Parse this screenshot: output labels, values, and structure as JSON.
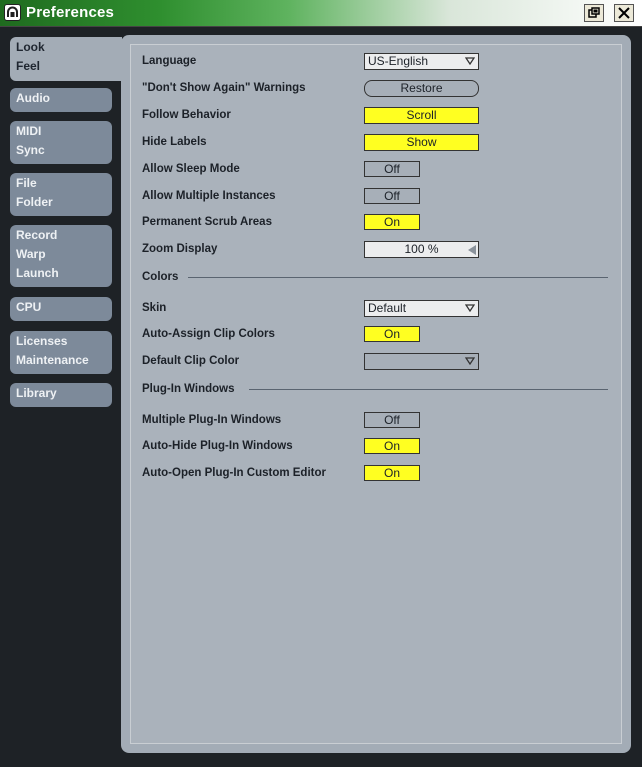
{
  "window": {
    "title": "Preferences"
  },
  "sidebar": {
    "tabs": [
      {
        "lines": [
          "Look",
          "Feel"
        ]
      },
      {
        "lines": [
          "Audio"
        ]
      },
      {
        "lines": [
          "MIDI",
          "Sync"
        ]
      },
      {
        "lines": [
          "File",
          "Folder"
        ]
      },
      {
        "lines": [
          "Record",
          "Warp",
          "Launch"
        ]
      },
      {
        "lines": [
          "CPU"
        ]
      },
      {
        "lines": [
          "Licenses",
          "Maintenance"
        ]
      },
      {
        "lines": [
          "Library"
        ]
      }
    ]
  },
  "settings": {
    "language": {
      "label": "Language",
      "value": "US-English"
    },
    "warnings": {
      "label": "\"Don't Show Again\" Warnings",
      "value": "Restore"
    },
    "follow": {
      "label": "Follow Behavior",
      "value": "Scroll"
    },
    "hide_labels": {
      "label": "Hide Labels",
      "value": "Show"
    },
    "sleep": {
      "label": "Allow Sleep Mode",
      "value": "Off"
    },
    "multi_instances": {
      "label": "Allow Multiple Instances",
      "value": "Off"
    },
    "scrub": {
      "label": "Permanent Scrub Areas",
      "value": "On"
    },
    "zoom": {
      "label": "Zoom Display",
      "value": "100 %"
    }
  },
  "colors": {
    "heading": "Colors",
    "skin": {
      "label": "Skin",
      "value": "Default"
    },
    "auto_assign": {
      "label": "Auto-Assign Clip Colors",
      "value": "On"
    },
    "default_clip": {
      "label": "Default Clip Color",
      "value": ""
    }
  },
  "plugins": {
    "heading": "Plug-In Windows",
    "multiple": {
      "label": "Multiple Plug-In Windows",
      "value": "Off"
    },
    "auto_hide": {
      "label": "Auto-Hide Plug-In Windows",
      "value": "On"
    },
    "auto_open": {
      "label": "Auto-Open Plug-In Custom Editor",
      "value": "On"
    }
  },
  "theme": {
    "titlebar_green": "#2f8f2f",
    "panel": "#a3acb6",
    "toggle_on": "#ffff21",
    "background": "#1e2226"
  }
}
